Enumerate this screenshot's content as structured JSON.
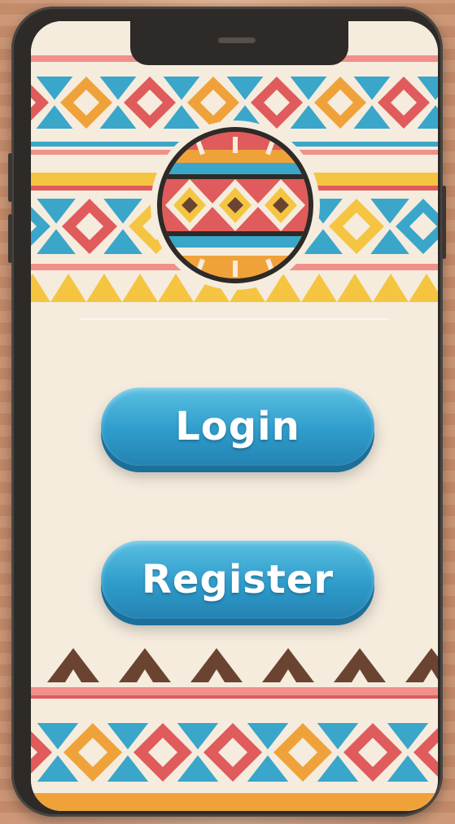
{
  "screen": {
    "logo_icon": "tribal-pattern-emblem-icon",
    "buttons": {
      "login_label": "Login",
      "register_label": "Register"
    }
  },
  "colors": {
    "button_blue": "#2e9ccb",
    "background_cream": "#f5ecde",
    "pattern_red": "#e05b5b",
    "pattern_orange": "#f0a23a",
    "pattern_blue": "#3aa6c9",
    "pattern_yellow": "#f5c542",
    "pattern_brown": "#6b4431",
    "pattern_pink": "#f0908a"
  }
}
